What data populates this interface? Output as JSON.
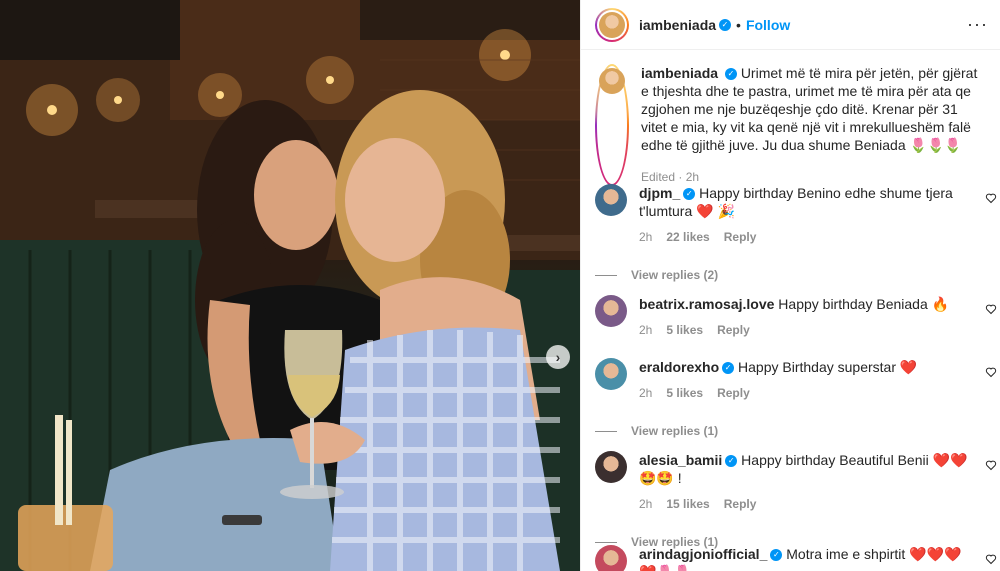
{
  "header": {
    "username": "iambeniada",
    "separator": "•",
    "follow_label": "Follow",
    "more_label": "···"
  },
  "photo": {
    "next_label": "›"
  },
  "caption": {
    "username": "iambeniada",
    "text": "Urimet më të mira për jetën, për gjërat e thjeshta dhe te pastra, urimet me të mira për ata qe zgjohen me nje buzëqeshje çdo ditë. Krenar për 31 vitet e mia, ky vit ka qenë një vit i mrekullueshëm falë edhe të gjithë juve. Ju dua shume Beniada 🌷🌷🌷",
    "edited": "Edited",
    "time": "2h"
  },
  "comments": [
    {
      "username": "djpm_",
      "verified": true,
      "text": "Happy birthday Benino edhe shume tjera t'lumtura ❤️ 🎉",
      "time": "2h",
      "likes": "22 likes",
      "reply_label": "Reply",
      "view_replies": "View replies (2)",
      "avatar_color": "#3f6b8c"
    },
    {
      "username": "beatrix.ramosaj.love",
      "verified": false,
      "text": "Happy birthday Beniada 🔥",
      "time": "2h",
      "likes": "5 likes",
      "reply_label": "Reply",
      "view_replies": "",
      "avatar_color": "#7a5a88"
    },
    {
      "username": "eraldorexho",
      "verified": true,
      "text": "Happy Birthday superstar ❤️",
      "time": "2h",
      "likes": "5 likes",
      "reply_label": "Reply",
      "view_replies": "View replies (1)",
      "avatar_color": "#4a8fa8"
    },
    {
      "username": "alesia_bamii",
      "verified": true,
      "text": "Happy birthday Beautiful Benii ❤️❤️🤩🤩 !",
      "time": "2h",
      "likes": "15 likes",
      "reply_label": "Reply",
      "view_replies": "View replies (1)",
      "avatar_color": "#3b2f2f"
    },
    {
      "username": "arindagjoniofficial_",
      "verified": true,
      "text": "Motra ime e shpirtit ❤️❤️❤️❤️🌷🌷",
      "time": "",
      "likes": "",
      "reply_label": "",
      "view_replies": "",
      "avatar_color": "#c44a5e"
    }
  ],
  "icons": {
    "verified": "verified-badge-icon",
    "heart": "heart-outline-icon",
    "next": "chevron-right-icon"
  },
  "colors": {
    "link_blue": "#0095f6",
    "muted": "#8e8e8e",
    "text": "#262626"
  }
}
